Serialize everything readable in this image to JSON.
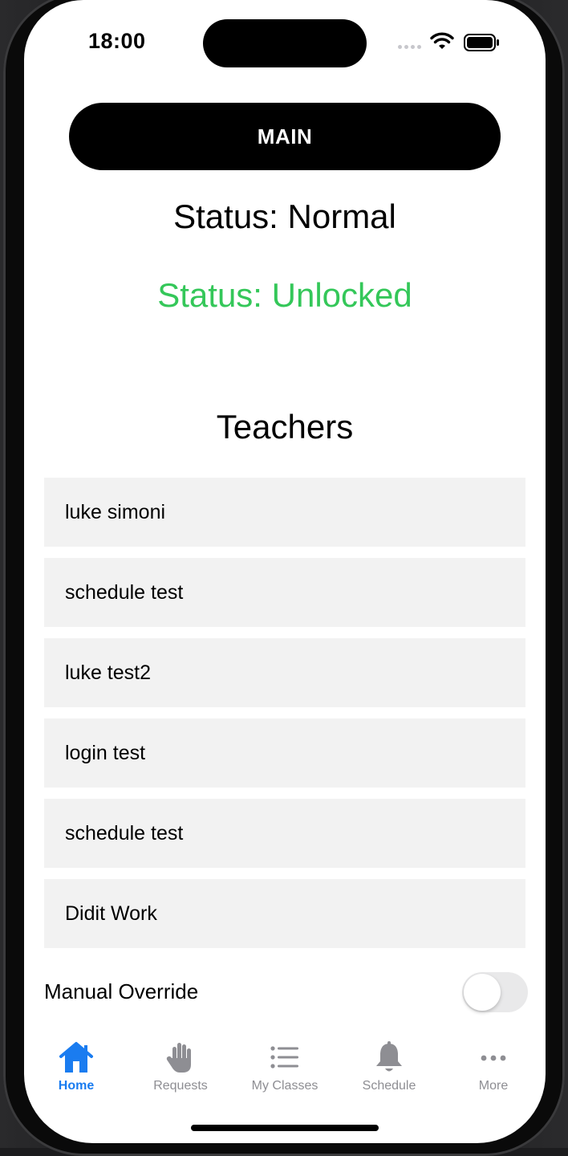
{
  "status_bar": {
    "time": "18:00"
  },
  "main_button_label": "MAIN",
  "status_mode": "Status: Normal",
  "status_lock": "Status: Unlocked",
  "colors": {
    "unlocked_green": "#34c759",
    "tab_active_blue": "#1a7cf0",
    "tab_inactive_gray": "#8e8e93"
  },
  "teachers": {
    "title": "Teachers",
    "items": [
      "luke simoni",
      "schedule test",
      "luke test2",
      "login test",
      "schedule test",
      "Didit Work"
    ]
  },
  "manual_override": {
    "label": "Manual Override",
    "enabled": false
  },
  "tabs": [
    {
      "label": "Home",
      "icon": "house-icon",
      "active": true
    },
    {
      "label": "Requests",
      "icon": "hand-icon",
      "active": false
    },
    {
      "label": "My Classes",
      "icon": "list-icon",
      "active": false
    },
    {
      "label": "Schedule",
      "icon": "bell-icon",
      "active": false
    },
    {
      "label": "More",
      "icon": "ellipsis-icon",
      "active": false
    }
  ]
}
